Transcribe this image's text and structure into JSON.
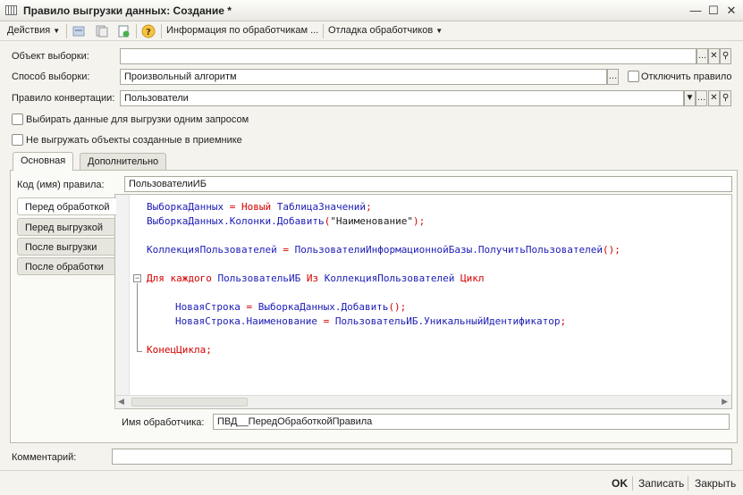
{
  "window": {
    "title": "Правило выгрузки данных: Создание *"
  },
  "toolbar": {
    "actions_label": "Действия",
    "handlers_info_label": "Информация по обработчикам ...",
    "debug_label": "Отладка обработчиков"
  },
  "form": {
    "object_label": "Объект выборки:",
    "object_value": "",
    "method_label": "Способ выборки:",
    "method_value": "Произвольный алгоритм",
    "disable_rule_label": "Отключить правило",
    "conversion_label": "Правило конвертации:",
    "conversion_value": "Пользователи",
    "one_query_label": "Выбирать данные для выгрузки одним запросом",
    "no_receiver_label": "Не выгружать объекты созданные в приемнике"
  },
  "tabs": [
    {
      "label": "Основная"
    },
    {
      "label": "Дополнительно"
    }
  ],
  "main_tab": {
    "code_label": "Код (имя) правила:",
    "code_value": "ПользователиИБ",
    "handler_tabs": [
      {
        "label": "Перед обработкой"
      },
      {
        "label": "Перед выгрузкой"
      },
      {
        "label": "После выгрузки"
      },
      {
        "label": "После обработки"
      }
    ],
    "code": {
      "l1a": "ВыборкаДанных",
      "l1b": " = ",
      "l1c": "Новый",
      "l1d": " ТаблицаЗначений",
      "l1e": ";",
      "l2a": "ВыборкаДанных.Колонки.Добавить",
      "l2b": "(",
      "l2c": "\"Наименование\"",
      "l2d": ");",
      "l3a": "КоллекцияПользователей",
      "l3b": " = ",
      "l3c": "ПользователиИнформационнойБазы.ПолучитьПользователей",
      "l3d": "();",
      "l4a": "Для каждого",
      "l4b": " ПользовательИБ ",
      "l4c": "Из",
      "l4d": " КоллекцияПользователей ",
      "l4e": "Цикл",
      "l5a": "НоваяСтрока",
      "l5b": " = ",
      "l5c": "ВыборкаДанных.Добавить",
      "l5d": "();",
      "l6a": "НоваяСтрока.Наименование",
      "l6b": " = ",
      "l6c": "ПользовательИБ.УникальныйИдентификатор",
      "l6d": ";",
      "l7a": "КонецЦикла",
      "l7b": ";"
    },
    "handler_name_label": "Имя обработчика:",
    "handler_name_value": "ПВД__ПередОбработкойПравила"
  },
  "comment_label": "Комментарий:",
  "comment_value": "",
  "buttons": {
    "ok": "OK",
    "save": "Записать",
    "close": "Закрыть"
  }
}
